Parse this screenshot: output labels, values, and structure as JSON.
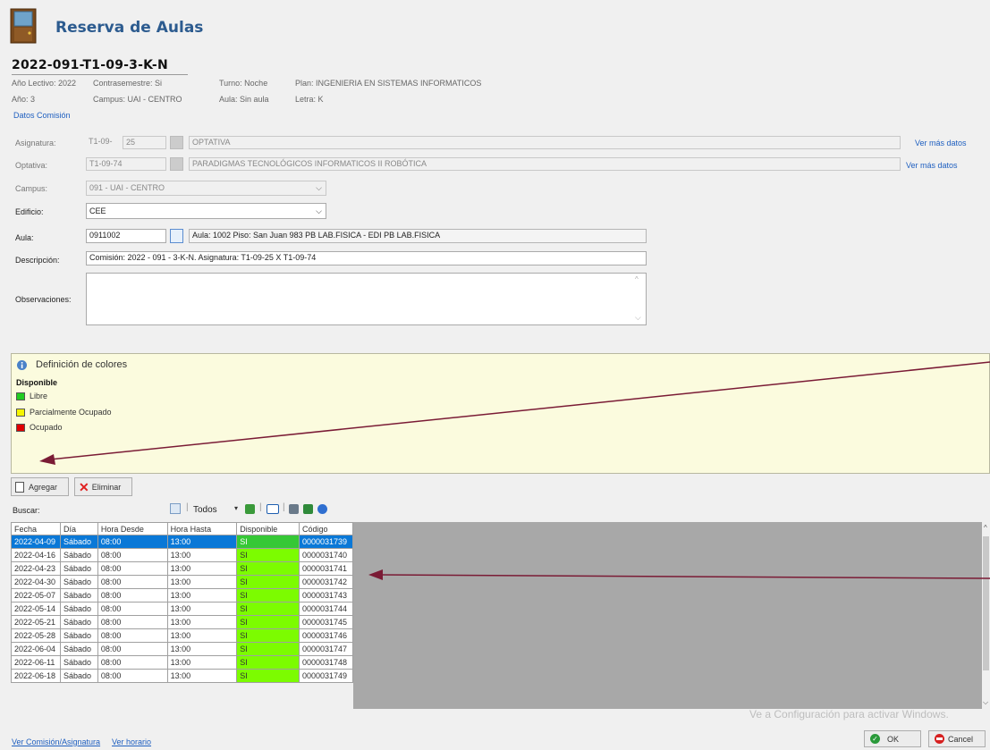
{
  "header": {
    "app_title": "Reserva de Aulas",
    "code": "2022-091-T1-09-3-K-N",
    "info": {
      "anio_lectivo": "Año Lectivo: 2022",
      "contrasemestre": "Contrasemestre: Si",
      "turno": "Turno: Noche",
      "plan": "Plan: INGENIERIA EN SISTEMAS INFORMATICOS",
      "anio": "Año: 3",
      "campus": "Campus: UAI - CENTRO",
      "aula": "Aula: Sin aula",
      "letra": "Letra: K"
    },
    "datos_comision_link": "Datos Comisión"
  },
  "form": {
    "asignatura": {
      "label": "Asignatura:",
      "code": "T1-09-",
      "num": "25",
      "name": "OPTATIVA",
      "link": "Ver más datos"
    },
    "optativa": {
      "label": "Optativa:",
      "code": "T1-09-74",
      "name": "PARADIGMAS TECNOLÓGICOS INFORMATICOS II ROBÓTICA",
      "link": "Ver más datos"
    },
    "campus": {
      "label": "Campus:",
      "value": "091 - UAI - CENTRO"
    },
    "edificio": {
      "label": "Edificio:",
      "value": "CEE"
    },
    "aula": {
      "label": "Aula:",
      "code": "0911002",
      "desc": "Aula: 1002 Piso: San Juan 983 PB LAB.FISICA - EDI PB LAB.FISICA"
    },
    "descripcion": {
      "label": "Descripción:",
      "value": "Comisión: 2022  -  091  -  3-K-N. Asignatura: T1-09-25 X T1-09-74"
    },
    "observaciones": {
      "label": "Observaciones:",
      "value": ""
    }
  },
  "legend": {
    "title": "Definición de colores",
    "subtitle": "Disponible",
    "items": [
      {
        "label": "Libre",
        "color": "#22cc22"
      },
      {
        "label": "Parcialmente Ocupado",
        "color": "#f5f500"
      },
      {
        "label": "Ocupado",
        "color": "#e00000"
      }
    ]
  },
  "actions": {
    "add": "Agregar",
    "remove": "Eliminar"
  },
  "search": {
    "label": "Buscar:",
    "filter": "Todos"
  },
  "table": {
    "columns": [
      "Fecha",
      "Día",
      "Hora Desde",
      "Hora Hasta",
      "Disponible",
      "Código"
    ],
    "rows": [
      [
        "2022-04-09",
        "Sábado",
        "08:00",
        "13:00",
        "SI",
        "0000031739"
      ],
      [
        "2022-04-16",
        "Sábado",
        "08:00",
        "13:00",
        "SI",
        "0000031740"
      ],
      [
        "2022-04-23",
        "Sábado",
        "08:00",
        "13:00",
        "SI",
        "0000031741"
      ],
      [
        "2022-04-30",
        "Sábado",
        "08:00",
        "13:00",
        "SI",
        "0000031742"
      ],
      [
        "2022-05-07",
        "Sábado",
        "08:00",
        "13:00",
        "SI",
        "0000031743"
      ],
      [
        "2022-05-14",
        "Sábado",
        "08:00",
        "13:00",
        "SI",
        "0000031744"
      ],
      [
        "2022-05-21",
        "Sábado",
        "08:00",
        "13:00",
        "SI",
        "0000031745"
      ],
      [
        "2022-05-28",
        "Sábado",
        "08:00",
        "13:00",
        "SI",
        "0000031746"
      ],
      [
        "2022-06-04",
        "Sábado",
        "08:00",
        "13:00",
        "SI",
        "0000031747"
      ],
      [
        "2022-06-11",
        "Sábado",
        "08:00",
        "13:00",
        "SI",
        "0000031748"
      ],
      [
        "2022-06-18",
        "Sábado",
        "08:00",
        "13:00",
        "SI",
        "0000031749"
      ]
    ]
  },
  "footer": {
    "ver_comision": "Ver Comisión/Asignatura",
    "ver_horario": "Ver horario",
    "ok": "OK",
    "cancel": "Cancel",
    "watermark": "Ve a Configuración para activar Windows."
  },
  "colors": {
    "accent": "#2c5b8f",
    "selected_row": "#0a78d7",
    "available": "#7cfc00",
    "arrow": "#7a1b35"
  }
}
